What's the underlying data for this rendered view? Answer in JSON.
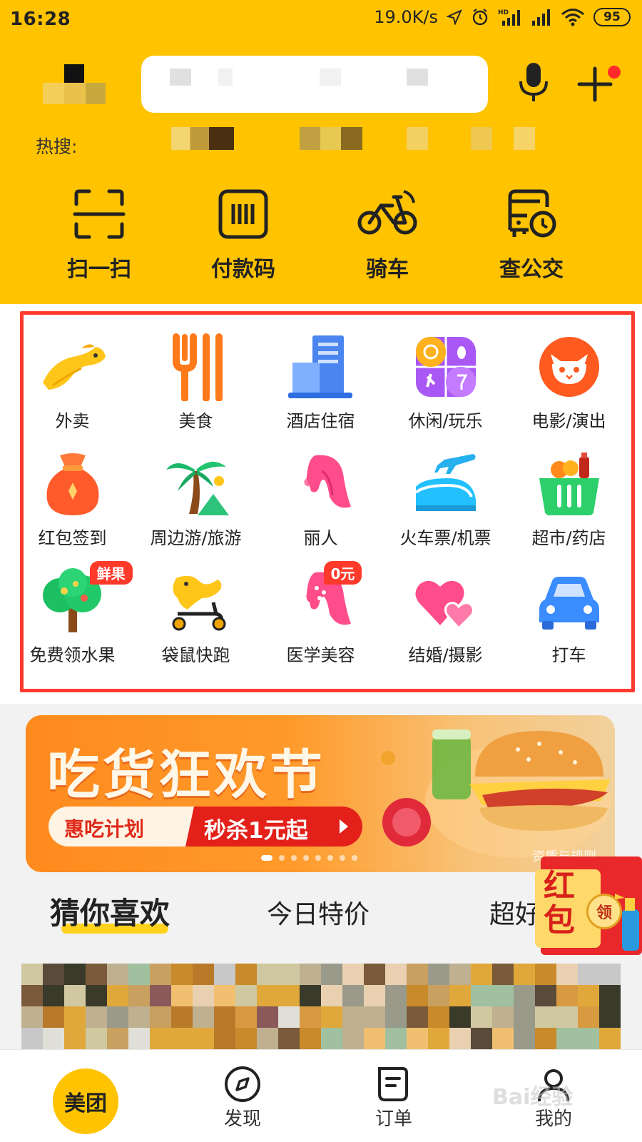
{
  "status_bar": {
    "time": "16:28",
    "network_speed": "19.0K/s",
    "network_type": "HD",
    "battery": "95"
  },
  "header": {
    "hot_search_label": "热搜:",
    "quick_actions": [
      {
        "label": "扫一扫",
        "icon": "scan-icon"
      },
      {
        "label": "付款码",
        "icon": "payment-code-icon"
      },
      {
        "label": "骑车",
        "icon": "bike-icon"
      },
      {
        "label": "查公交",
        "icon": "bus-icon"
      }
    ]
  },
  "categories": [
    {
      "label": "外卖",
      "icon": "kangaroo-icon"
    },
    {
      "label": "美食",
      "icon": "fork-icon"
    },
    {
      "label": "酒店住宿",
      "icon": "hotel-building-icon"
    },
    {
      "label": "休闲/玩乐",
      "icon": "leisure-grid-icon"
    },
    {
      "label": "电影/演出",
      "icon": "cat-face-icon"
    },
    {
      "label": "红包签到",
      "icon": "money-bag-icon"
    },
    {
      "label": "周边游/旅游",
      "icon": "palm-tree-icon"
    },
    {
      "label": "丽人",
      "icon": "woman-profile-icon"
    },
    {
      "label": "火车票/机票",
      "icon": "train-plane-icon"
    },
    {
      "label": "超市/药店",
      "icon": "shopping-basket-icon"
    },
    {
      "label": "免费领水果",
      "icon": "fruit-tree-icon",
      "badge": "鲜果"
    },
    {
      "label": "袋鼠快跑",
      "icon": "kangaroo-scooter-icon"
    },
    {
      "label": "医学美容",
      "icon": "face-beauty-icon",
      "badge": "0元"
    },
    {
      "label": "结婚/摄影",
      "icon": "hearts-icon"
    },
    {
      "label": "打车",
      "icon": "car-icon"
    }
  ],
  "banner": {
    "title": "吃货狂欢节",
    "pill_left": "惠吃计划",
    "pill_right": "秒杀1元起",
    "qualification": "资质与规则",
    "slides": 8,
    "active_slide": 0
  },
  "recommend_tabs": [
    "猜你喜欢",
    "今日特价",
    "超好"
  ],
  "red_packet": {
    "text": "红包",
    "coin": "领"
  },
  "bottom_nav": [
    {
      "label": "美团",
      "icon": "meituan-logo"
    },
    {
      "label": "发现",
      "icon": "compass-icon"
    },
    {
      "label": "订单",
      "icon": "order-icon"
    },
    {
      "label": "我的",
      "icon": "profile-icon"
    }
  ],
  "watermark": "Bai经验",
  "colors": {
    "brand_yellow": "#ffc300",
    "highlight_red": "#ff3b2f",
    "banner_orange": "#ff8a1e"
  }
}
